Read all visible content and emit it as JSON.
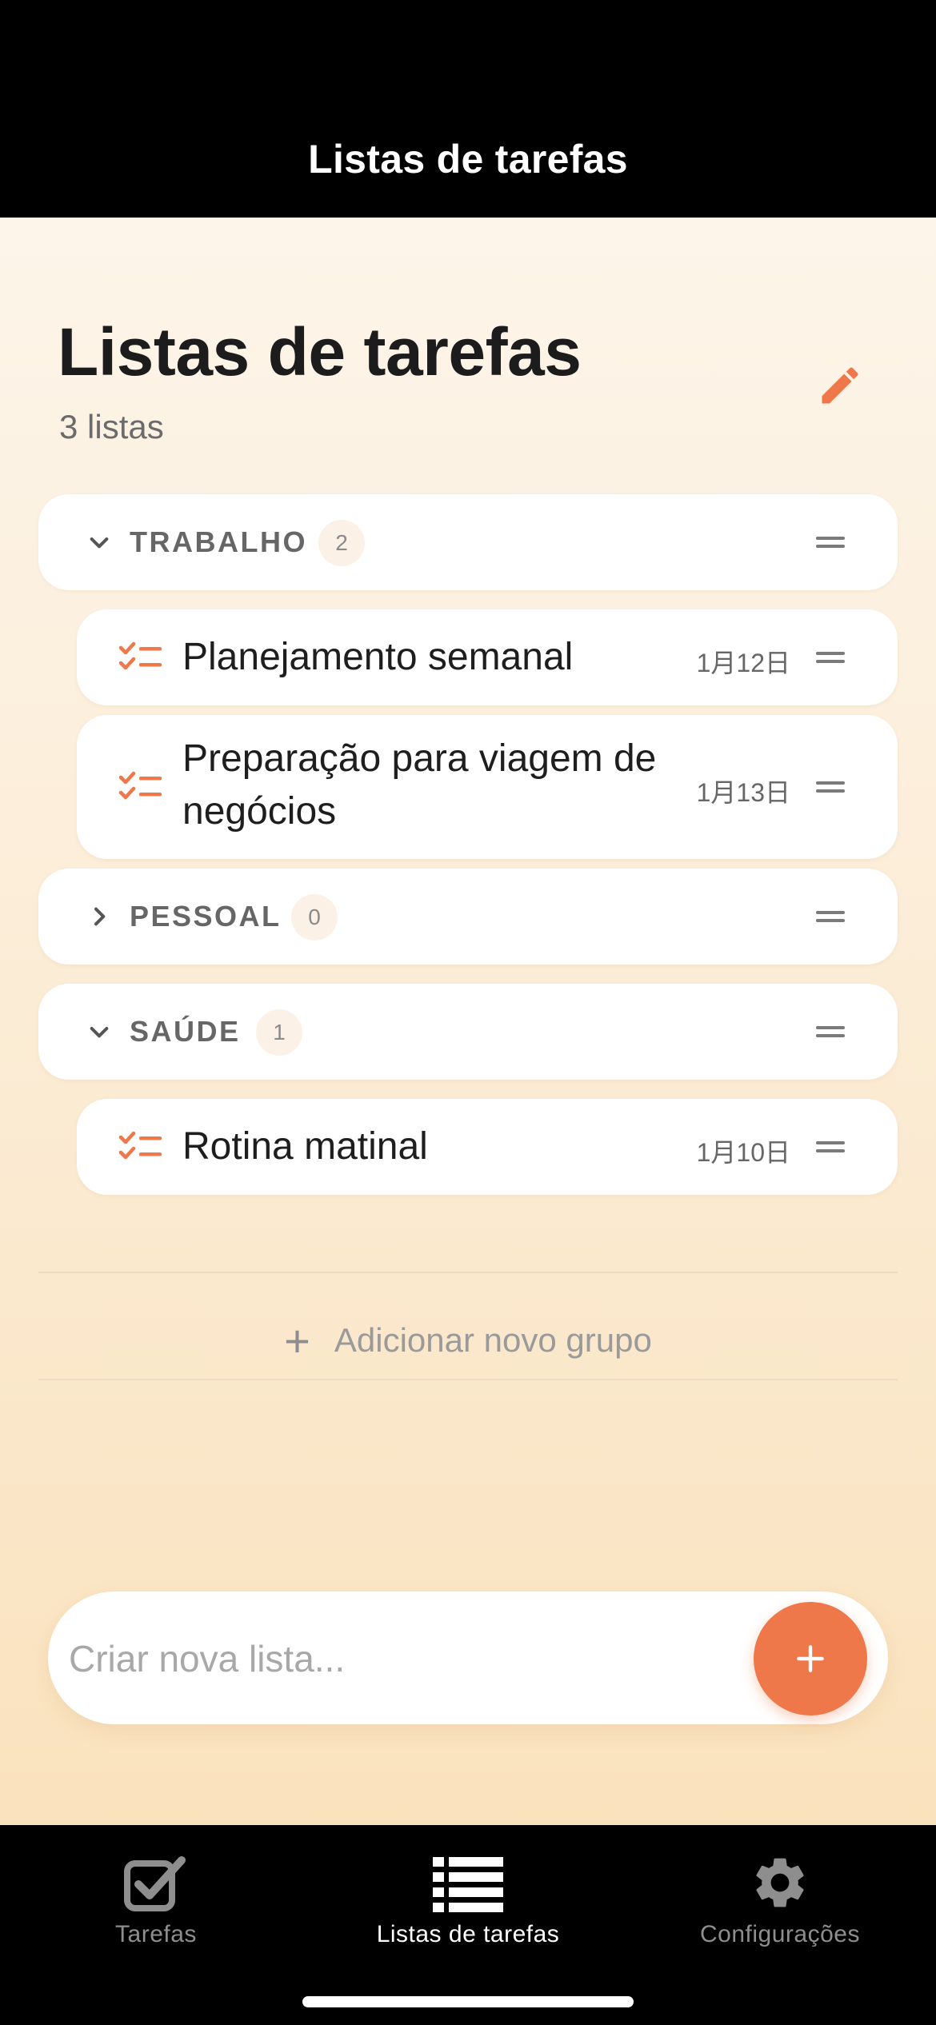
{
  "header": {
    "title": "Listas de tarefas"
  },
  "page": {
    "title": "Listas de tarefas",
    "subtitle": "3 listas",
    "edit_icon": "pencil-icon"
  },
  "groups": [
    {
      "name": "TRABALHO",
      "count": "2",
      "expanded": true,
      "lists": [
        {
          "title": "Planejamento semanal",
          "date": "1月12日"
        },
        {
          "title_line1": "Preparação para viagem de",
          "title_line2": "negócios",
          "date": "1月13日"
        }
      ]
    },
    {
      "name": "PESSOAL",
      "count": "0",
      "expanded": false,
      "lists": []
    },
    {
      "name": "SAÚDE",
      "count": "1",
      "expanded": true,
      "lists": [
        {
          "title": "Rotina matinal",
          "date": "1月10日"
        }
      ]
    }
  ],
  "add_group": {
    "label": "Adicionar novo grupo"
  },
  "new_list": {
    "placeholder": "Criar nova lista...",
    "value": ""
  },
  "tabs": [
    {
      "label": "Tarefas",
      "icon": "checkbox-icon",
      "active": false
    },
    {
      "label": "Listas de tarefas",
      "icon": "list-icon",
      "active": true
    },
    {
      "label": "Configurações",
      "icon": "gear-icon",
      "active": false
    }
  ],
  "colors": {
    "accent": "#ee7849",
    "tab_active": "#ffffff",
    "tab_inactive": "#8e8e8e"
  }
}
